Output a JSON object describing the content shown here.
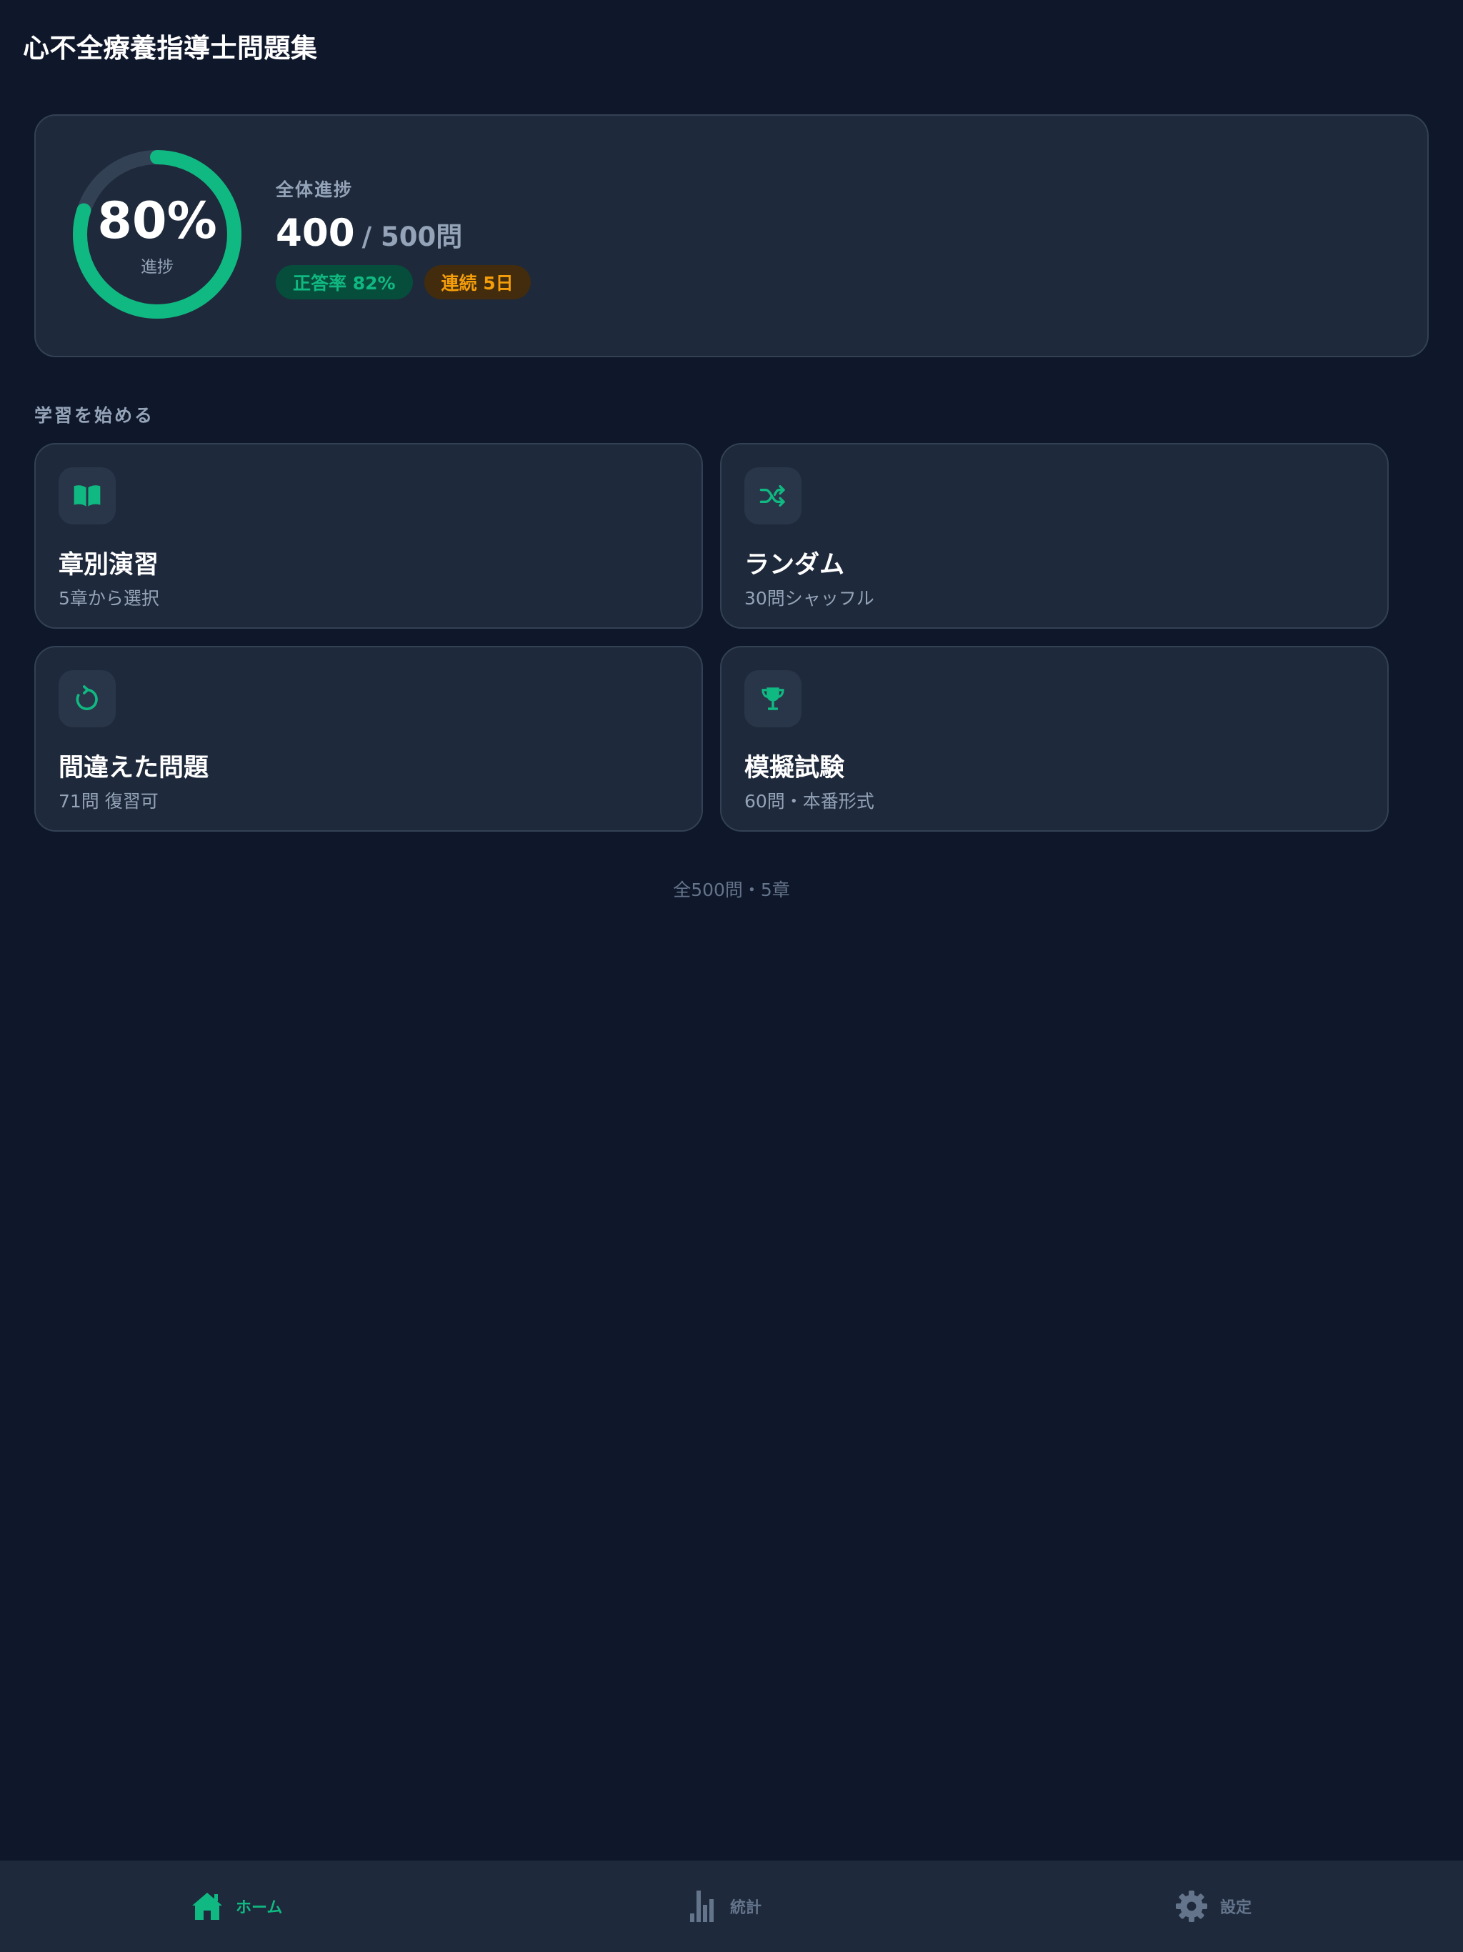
{
  "header": {
    "title": "心不全療養指導士問題集"
  },
  "progress": {
    "percent_text": "80%",
    "percent_value": 80,
    "ring_label": "進捗",
    "label": "全体進捗",
    "done": "400",
    "total": "/ 500問",
    "badges": {
      "accuracy": "正答率 82%",
      "streak": "連続 5日"
    }
  },
  "section": {
    "label": "学習を始める"
  },
  "cards": [
    {
      "title": "章別演習",
      "subtitle": "5章から選択",
      "icon": "book-open-icon"
    },
    {
      "title": "ランダム",
      "subtitle": "30問シャッフル",
      "icon": "shuffle-icon"
    },
    {
      "title": "間違えた問題",
      "subtitle": "71問 復習可",
      "icon": "redo-icon"
    },
    {
      "title": "模擬試験",
      "subtitle": "60問・本番形式",
      "icon": "trophy-icon"
    }
  ],
  "footer": {
    "note": "全500問・5章"
  },
  "tabbar": {
    "tabs": [
      {
        "label": "ホーム",
        "icon": "home-icon",
        "active": true
      },
      {
        "label": "統計",
        "icon": "bar-chart-icon",
        "active": false
      },
      {
        "label": "設定",
        "icon": "gear-icon",
        "active": false
      }
    ]
  },
  "colors": {
    "accent": "#10b981",
    "background": "#0f172a",
    "surface": "#1e293b",
    "muted_text": "#94a3b8",
    "streak": "#f59e0b",
    "inactive_tab": "#64748b"
  }
}
